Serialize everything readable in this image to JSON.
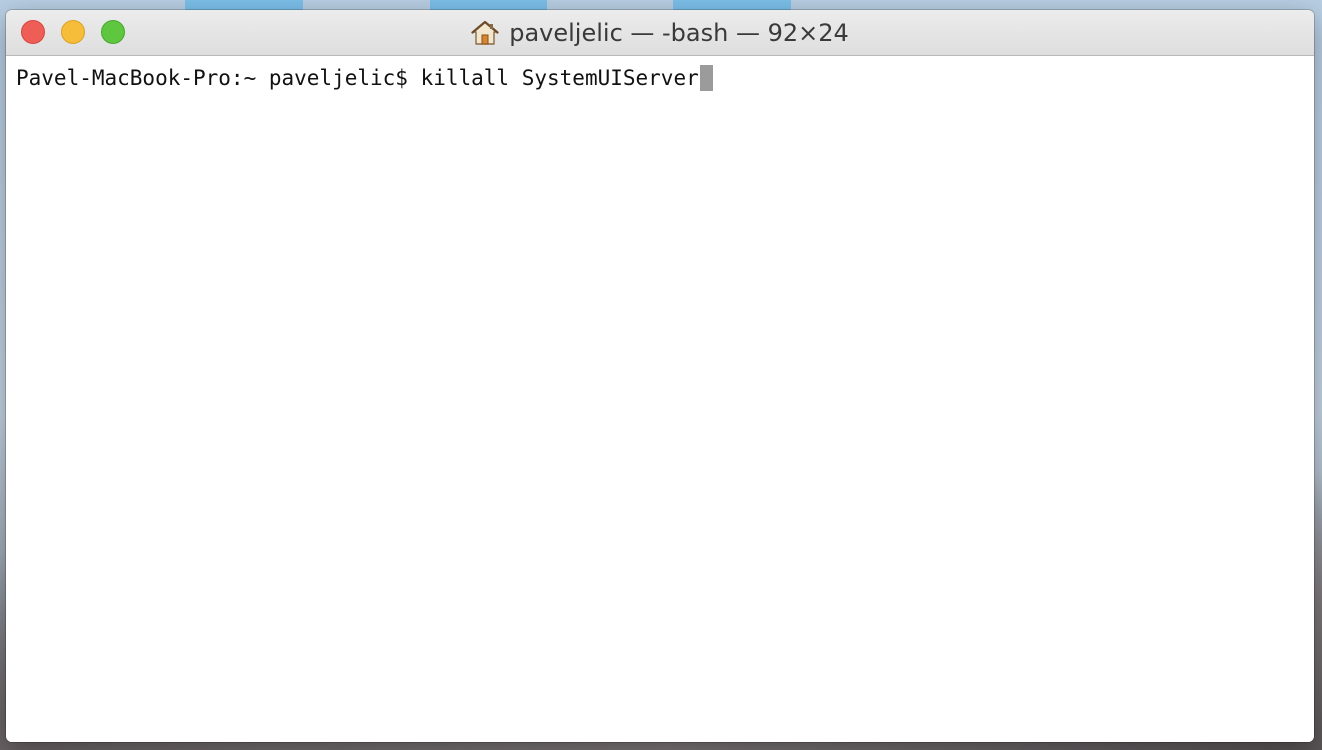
{
  "window": {
    "title": "paveljelic — -bash — 92×24",
    "title_icon": "home-folder-icon"
  },
  "traffic_lights": {
    "close_color": "#ee5e57",
    "minimize_color": "#f5bd3a",
    "zoom_color": "#5fc73f"
  },
  "terminal": {
    "prompt": "Pavel-MacBook-Pro:~ paveljelic$ ",
    "command": "killall SystemUIServer",
    "cursor_color": "#9b9b9b"
  }
}
